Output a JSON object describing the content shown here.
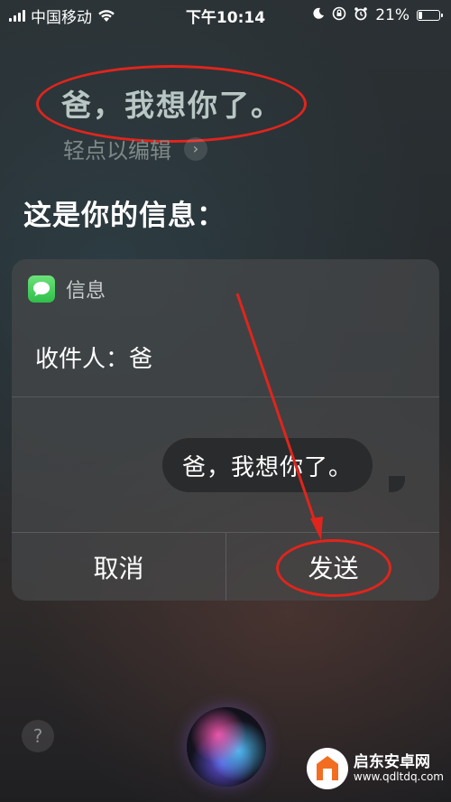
{
  "status_bar": {
    "carrier": "中国移动",
    "time": "下午10:14",
    "battery_percent": "21%",
    "battery_level": 0.21
  },
  "siri": {
    "transcript": "爸，我想你了。",
    "edit_hint": "轻点以编辑",
    "reply": "这是你的信息："
  },
  "message_card": {
    "app_name": "信息",
    "recipient": "收件人：爸",
    "message": "爸，我想你了。",
    "cancel_label": "取消",
    "send_label": "发送"
  },
  "bottom": {
    "help_label": "?"
  },
  "watermark": {
    "title": "启东安卓网",
    "url": "www.qdltdq.com"
  },
  "colors": {
    "annotation_red": "#e0251c",
    "messages_green": "#34c759"
  }
}
